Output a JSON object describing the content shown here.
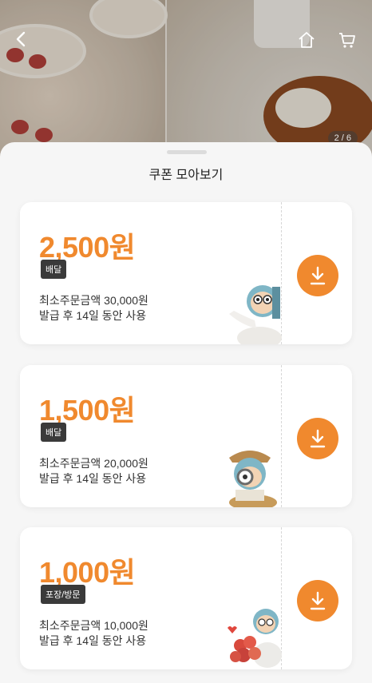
{
  "header": {
    "back_icon": "back-arrow-icon",
    "home_icon": "home-icon",
    "cart_icon": "cart-icon",
    "image_counter": "2 / 6"
  },
  "sheet": {
    "title": "쿠폰 모아보기"
  },
  "coupons": [
    {
      "amount": "2,500원",
      "badge": "배달",
      "min_order": "최소주문금액 30,000원",
      "validity": "발급 후 14일 동안 사용"
    },
    {
      "amount": "1,500원",
      "badge": "배달",
      "min_order": "최소주문금액 20,000원",
      "validity": "발급 후 14일 동안 사용"
    },
    {
      "amount": "1,000원",
      "badge": "포장/방문",
      "min_order": "최소주문금액 10,000원",
      "validity": "발급 후 14일 동안 사용"
    }
  ],
  "colors": {
    "accent": "#f0892e",
    "badge_bg": "#3a3a3a"
  }
}
